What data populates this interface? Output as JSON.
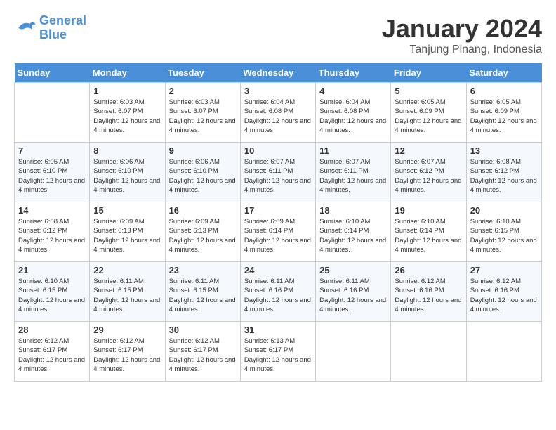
{
  "header": {
    "logo_line1": "General",
    "logo_line2": "Blue",
    "month_year": "January 2024",
    "location": "Tanjung Pinang, Indonesia"
  },
  "days_of_week": [
    "Sunday",
    "Monday",
    "Tuesday",
    "Wednesday",
    "Thursday",
    "Friday",
    "Saturday"
  ],
  "weeks": [
    [
      {
        "day": "",
        "sunrise": "",
        "sunset": "",
        "daylight": ""
      },
      {
        "day": "1",
        "sunrise": "Sunrise: 6:03 AM",
        "sunset": "Sunset: 6:07 PM",
        "daylight": "Daylight: 12 hours and 4 minutes."
      },
      {
        "day": "2",
        "sunrise": "Sunrise: 6:03 AM",
        "sunset": "Sunset: 6:07 PM",
        "daylight": "Daylight: 12 hours and 4 minutes."
      },
      {
        "day": "3",
        "sunrise": "Sunrise: 6:04 AM",
        "sunset": "Sunset: 6:08 PM",
        "daylight": "Daylight: 12 hours and 4 minutes."
      },
      {
        "day": "4",
        "sunrise": "Sunrise: 6:04 AM",
        "sunset": "Sunset: 6:08 PM",
        "daylight": "Daylight: 12 hours and 4 minutes."
      },
      {
        "day": "5",
        "sunrise": "Sunrise: 6:05 AM",
        "sunset": "Sunset: 6:09 PM",
        "daylight": "Daylight: 12 hours and 4 minutes."
      },
      {
        "day": "6",
        "sunrise": "Sunrise: 6:05 AM",
        "sunset": "Sunset: 6:09 PM",
        "daylight": "Daylight: 12 hours and 4 minutes."
      }
    ],
    [
      {
        "day": "7",
        "sunrise": "Sunrise: 6:05 AM",
        "sunset": "Sunset: 6:10 PM",
        "daylight": "Daylight: 12 hours and 4 minutes."
      },
      {
        "day": "8",
        "sunrise": "Sunrise: 6:06 AM",
        "sunset": "Sunset: 6:10 PM",
        "daylight": "Daylight: 12 hours and 4 minutes."
      },
      {
        "day": "9",
        "sunrise": "Sunrise: 6:06 AM",
        "sunset": "Sunset: 6:10 PM",
        "daylight": "Daylight: 12 hours and 4 minutes."
      },
      {
        "day": "10",
        "sunrise": "Sunrise: 6:07 AM",
        "sunset": "Sunset: 6:11 PM",
        "daylight": "Daylight: 12 hours and 4 minutes."
      },
      {
        "day": "11",
        "sunrise": "Sunrise: 6:07 AM",
        "sunset": "Sunset: 6:11 PM",
        "daylight": "Daylight: 12 hours and 4 minutes."
      },
      {
        "day": "12",
        "sunrise": "Sunrise: 6:07 AM",
        "sunset": "Sunset: 6:12 PM",
        "daylight": "Daylight: 12 hours and 4 minutes."
      },
      {
        "day": "13",
        "sunrise": "Sunrise: 6:08 AM",
        "sunset": "Sunset: 6:12 PM",
        "daylight": "Daylight: 12 hours and 4 minutes."
      }
    ],
    [
      {
        "day": "14",
        "sunrise": "Sunrise: 6:08 AM",
        "sunset": "Sunset: 6:12 PM",
        "daylight": "Daylight: 12 hours and 4 minutes."
      },
      {
        "day": "15",
        "sunrise": "Sunrise: 6:09 AM",
        "sunset": "Sunset: 6:13 PM",
        "daylight": "Daylight: 12 hours and 4 minutes."
      },
      {
        "day": "16",
        "sunrise": "Sunrise: 6:09 AM",
        "sunset": "Sunset: 6:13 PM",
        "daylight": "Daylight: 12 hours and 4 minutes."
      },
      {
        "day": "17",
        "sunrise": "Sunrise: 6:09 AM",
        "sunset": "Sunset: 6:14 PM",
        "daylight": "Daylight: 12 hours and 4 minutes."
      },
      {
        "day": "18",
        "sunrise": "Sunrise: 6:10 AM",
        "sunset": "Sunset: 6:14 PM",
        "daylight": "Daylight: 12 hours and 4 minutes."
      },
      {
        "day": "19",
        "sunrise": "Sunrise: 6:10 AM",
        "sunset": "Sunset: 6:14 PM",
        "daylight": "Daylight: 12 hours and 4 minutes."
      },
      {
        "day": "20",
        "sunrise": "Sunrise: 6:10 AM",
        "sunset": "Sunset: 6:15 PM",
        "daylight": "Daylight: 12 hours and 4 minutes."
      }
    ],
    [
      {
        "day": "21",
        "sunrise": "Sunrise: 6:10 AM",
        "sunset": "Sunset: 6:15 PM",
        "daylight": "Daylight: 12 hours and 4 minutes."
      },
      {
        "day": "22",
        "sunrise": "Sunrise: 6:11 AM",
        "sunset": "Sunset: 6:15 PM",
        "daylight": "Daylight: 12 hours and 4 minutes."
      },
      {
        "day": "23",
        "sunrise": "Sunrise: 6:11 AM",
        "sunset": "Sunset: 6:15 PM",
        "daylight": "Daylight: 12 hours and 4 minutes."
      },
      {
        "day": "24",
        "sunrise": "Sunrise: 6:11 AM",
        "sunset": "Sunset: 6:16 PM",
        "daylight": "Daylight: 12 hours and 4 minutes."
      },
      {
        "day": "25",
        "sunrise": "Sunrise: 6:11 AM",
        "sunset": "Sunset: 6:16 PM",
        "daylight": "Daylight: 12 hours and 4 minutes."
      },
      {
        "day": "26",
        "sunrise": "Sunrise: 6:12 AM",
        "sunset": "Sunset: 6:16 PM",
        "daylight": "Daylight: 12 hours and 4 minutes."
      },
      {
        "day": "27",
        "sunrise": "Sunrise: 6:12 AM",
        "sunset": "Sunset: 6:16 PM",
        "daylight": "Daylight: 12 hours and 4 minutes."
      }
    ],
    [
      {
        "day": "28",
        "sunrise": "Sunrise: 6:12 AM",
        "sunset": "Sunset: 6:17 PM",
        "daylight": "Daylight: 12 hours and 4 minutes."
      },
      {
        "day": "29",
        "sunrise": "Sunrise: 6:12 AM",
        "sunset": "Sunset: 6:17 PM",
        "daylight": "Daylight: 12 hours and 4 minutes."
      },
      {
        "day": "30",
        "sunrise": "Sunrise: 6:12 AM",
        "sunset": "Sunset: 6:17 PM",
        "daylight": "Daylight: 12 hours and 4 minutes."
      },
      {
        "day": "31",
        "sunrise": "Sunrise: 6:13 AM",
        "sunset": "Sunset: 6:17 PM",
        "daylight": "Daylight: 12 hours and 4 minutes."
      },
      {
        "day": "",
        "sunrise": "",
        "sunset": "",
        "daylight": ""
      },
      {
        "day": "",
        "sunrise": "",
        "sunset": "",
        "daylight": ""
      },
      {
        "day": "",
        "sunrise": "",
        "sunset": "",
        "daylight": ""
      }
    ]
  ]
}
